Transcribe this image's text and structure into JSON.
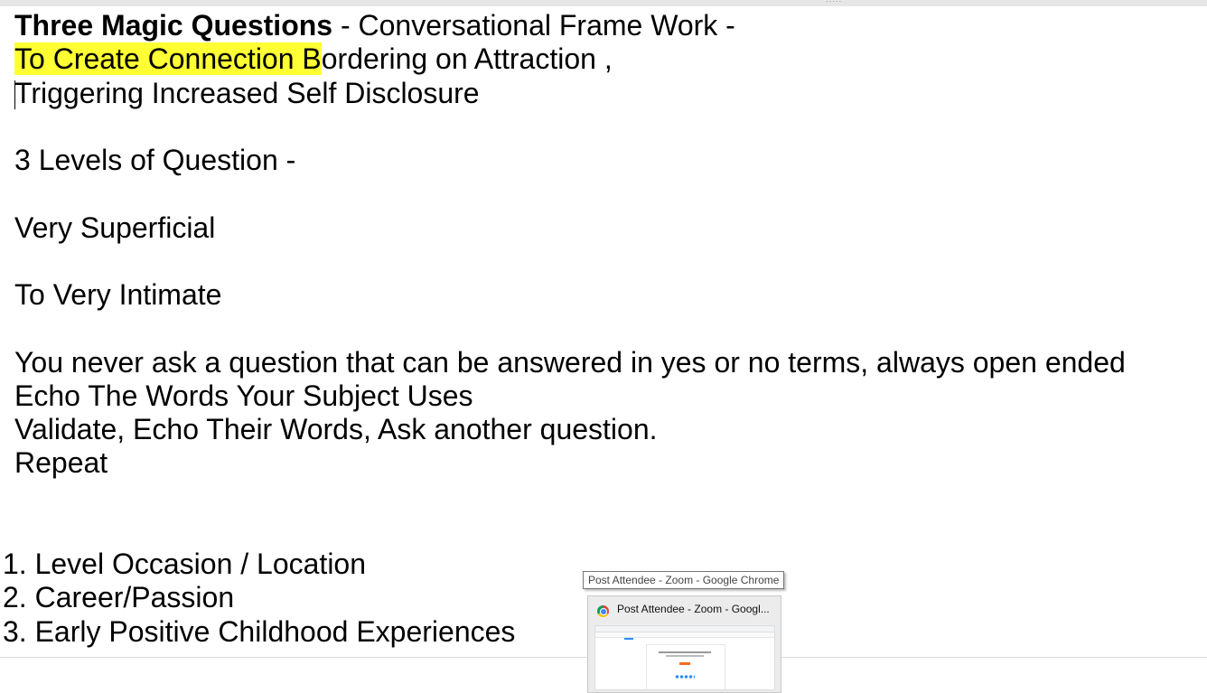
{
  "document": {
    "title_bold": "Three Magic Questions",
    "title_rest": " - Conversational Frame Work -",
    "line2_highlight": "To Create Connection B",
    "line2_rest": "ordering on Attraction ,",
    "line3": "Triggering Increased Self Disclosure",
    "line4": "3 Levels of Question -",
    "line5": "Very Superficial",
    "line6": "To Very Intimate",
    "line7": "You never ask a question that can be answered in yes or no terms, always open ended",
    "line8": "Echo The Words Your Subject Uses",
    "line9": "Validate, Echo Their Words, Ask another question.",
    "line10": "Repeat",
    "list": [
      "1. Level Occasion / Location",
      "2. Career/Passion",
      "3. Early Positive Childhood Experiences"
    ]
  },
  "taskbar_preview": {
    "tooltip": "Post Attendee - Zoom - Google Chrome",
    "thumb_title": "Post Attendee - Zoom - Googl...",
    "icon": "chrome-icon"
  },
  "colors": {
    "highlight": "#ffff33"
  }
}
